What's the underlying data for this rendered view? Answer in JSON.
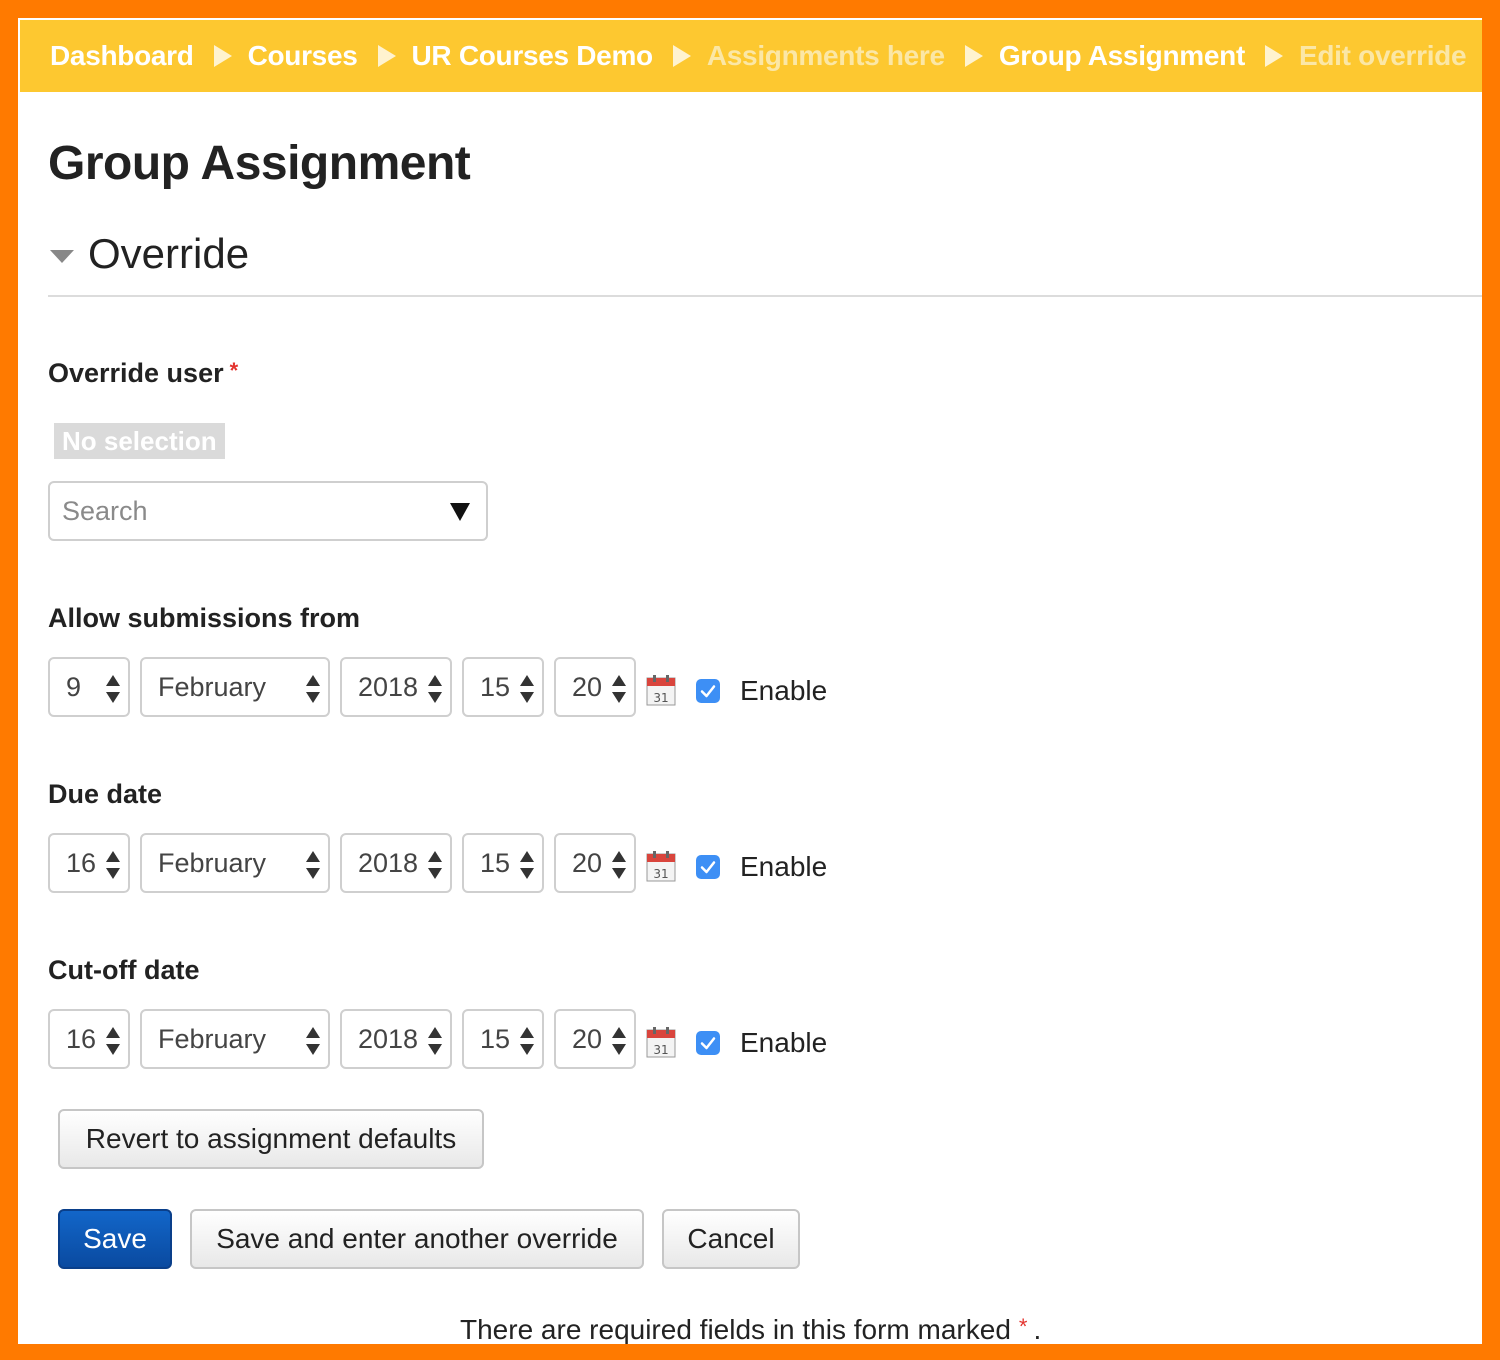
{
  "breadcrumb": [
    {
      "label": "Dashboard",
      "faded": false
    },
    {
      "label": "Courses",
      "faded": false
    },
    {
      "label": "UR Courses Demo",
      "faded": false
    },
    {
      "label": "Assignments here",
      "faded": true
    },
    {
      "label": "Group Assignment",
      "faded": false
    },
    {
      "label": "Edit override",
      "faded": true
    }
  ],
  "page": {
    "title": "Group Assignment",
    "section_title": "Override"
  },
  "override_user": {
    "label": "Override user",
    "required_marker": "*",
    "selection": "No selection",
    "search_placeholder": "Search"
  },
  "dates": {
    "allow_from": {
      "label": "Allow submissions from",
      "day": "9",
      "month": "February",
      "year": "2018",
      "hour": "15",
      "minute": "20",
      "enabled": true,
      "enable_label": "Enable"
    },
    "due": {
      "label": "Due date",
      "day": "16",
      "month": "February",
      "year": "2018",
      "hour": "15",
      "minute": "20",
      "enabled": true,
      "enable_label": "Enable"
    },
    "cutoff": {
      "label": "Cut-off date",
      "day": "16",
      "month": "February",
      "year": "2018",
      "hour": "15",
      "minute": "20",
      "enabled": true,
      "enable_label": "Enable"
    }
  },
  "calendar_icon": {
    "day_number": "31"
  },
  "buttons": {
    "revert": "Revert to assignment defaults",
    "save": "Save",
    "save_another": "Save and enter another override",
    "cancel": "Cancel"
  },
  "footer": {
    "note": "There are required fields in this form marked",
    "marker": "*",
    "end": "."
  },
  "colors": {
    "frame": "#ff7a00",
    "breadcrumb_bg": "#fdc830",
    "primary": "#0a4aa0",
    "checkbox": "#3d8ff5",
    "required": "#e3342f"
  }
}
